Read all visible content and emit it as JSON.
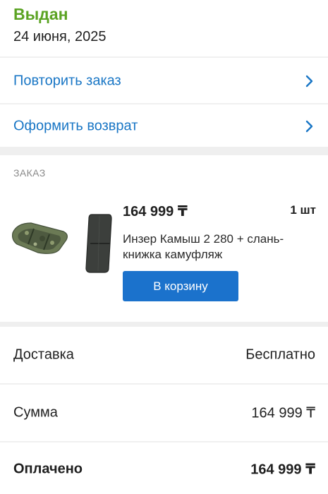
{
  "status": {
    "title": "Выдан",
    "date": "24 июня, 2025",
    "title_color": "#5ba323"
  },
  "actions": [
    {
      "label": "Повторить заказ",
      "icon": "chevron-right-icon"
    },
    {
      "label": "Оформить возврат",
      "icon": "chevron-right-icon"
    }
  ],
  "order": {
    "caption": "ЗАКАЗ",
    "item": {
      "price": "164 999 ₸",
      "quantity": "1 шт",
      "name": "Инзер Камыш 2 280 + слань-книжка камуфляж",
      "button_label": "В корзину",
      "images": [
        "boat-image",
        "floor-mat-image"
      ]
    }
  },
  "summary": [
    {
      "label": "Доставка",
      "value": "Бесплатно"
    },
    {
      "label": "Сумма",
      "value": "164 999 ₸"
    },
    {
      "label": "Оплачено",
      "value": "164 999 ₸"
    }
  ],
  "colors": {
    "accent": "#1976c5",
    "button": "#1b72cc",
    "status_green": "#5ba323",
    "band": "#efefef"
  }
}
